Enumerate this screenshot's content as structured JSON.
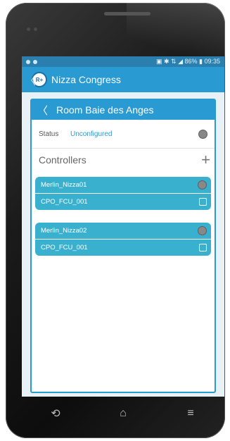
{
  "statusbar": {
    "right": "▣ ✱ ⇅ ◢ 86% ▮ 09:35"
  },
  "appbar": {
    "back": "〈",
    "logo": "R+",
    "title": "Nizza Congress"
  },
  "room": {
    "back": "〈",
    "title": "Room Baie des Anges",
    "status_label": "Status",
    "status_value": "Unconfigured"
  },
  "controllers": {
    "label": "Controllers",
    "add": "+",
    "groups": [
      {
        "name": "Merlin_Nizza01",
        "device": "CPO_FCU_001"
      },
      {
        "name": "Merlin_Nizza02",
        "device": "CPO_FCU_001"
      }
    ]
  },
  "nav": {
    "back": "⟲",
    "home": "⌂",
    "menu": "≡"
  },
  "colors": {
    "accent": "#2a9ad3",
    "group": "#3ab0cf",
    "status": "#2a7fae"
  }
}
